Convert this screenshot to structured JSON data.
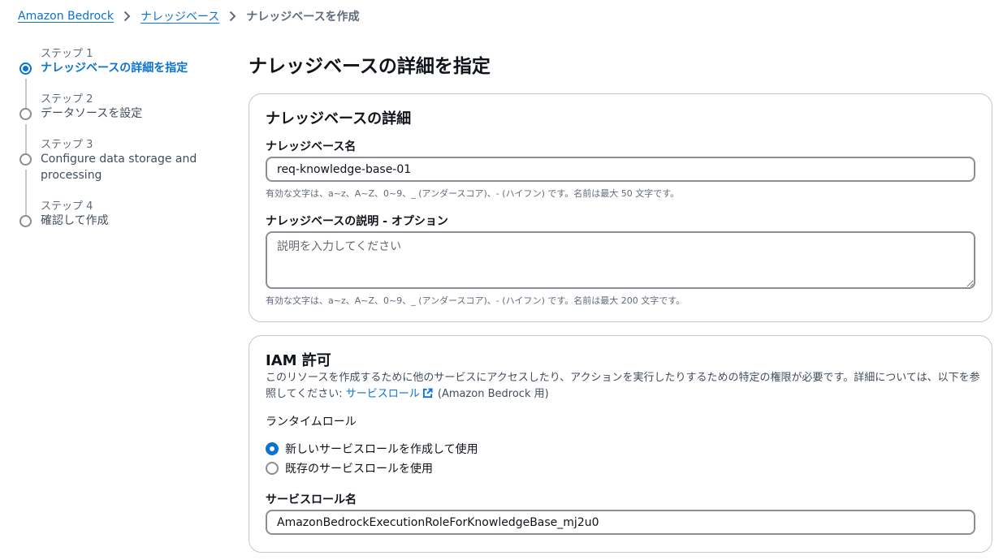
{
  "breadcrumb": {
    "items": [
      "Amazon Bedrock",
      "ナレッジベース"
    ],
    "current": "ナレッジベースを作成"
  },
  "steps": [
    {
      "label": "ステップ 1",
      "title": "ナレッジベースの詳細を指定",
      "active": true
    },
    {
      "label": "ステップ 2",
      "title": "データソースを設定",
      "active": false
    },
    {
      "label": "ステップ 3",
      "title": "Configure data storage and processing",
      "active": false
    },
    {
      "label": "ステップ 4",
      "title": "確認して作成",
      "active": false
    }
  ],
  "page_title": "ナレッジベースの詳細を指定",
  "details": {
    "title": "ナレッジベースの詳細",
    "name_label": "ナレッジベース名",
    "name_value": "req-knowledge-base-01",
    "name_constraint": "有効な文字は、a~z、A~Z、0~9、_ (アンダースコア)、- (ハイフン) です。名前は最大 50 文字です。",
    "desc_label": "ナレッジベースの説明 - オプション",
    "desc_placeholder": "説明を入力してください",
    "desc_constraint": "有効な文字は、a~z、A~Z、0~9、_ (アンダースコア)、- (ハイフン) です。名前は最大 200 文字です。"
  },
  "iam": {
    "title": "IAM 許可",
    "desc_prefix": "このリソースを作成するために他のサービスにアクセスしたり、アクションを実行したりするための特定の権限が必要です。詳細については、以下を参照してください: ",
    "link_text": "サービスロール",
    "desc_suffix": " (Amazon Bedrock 用)",
    "runtime_role_label": "ランタイムロール",
    "options": [
      {
        "label": "新しいサービスロールを作成して使用",
        "checked": true
      },
      {
        "label": "既存のサービスロールを使用",
        "checked": false
      }
    ],
    "role_name_label": "サービスロール名",
    "role_name_value": "AmazonBedrockExecutionRoleForKnowledgeBase_mj2u0"
  },
  "colors": {
    "accent": "#0972d3",
    "text": "#0f141a",
    "muted": "#5f6b7a",
    "border": "#c6c6cd"
  }
}
